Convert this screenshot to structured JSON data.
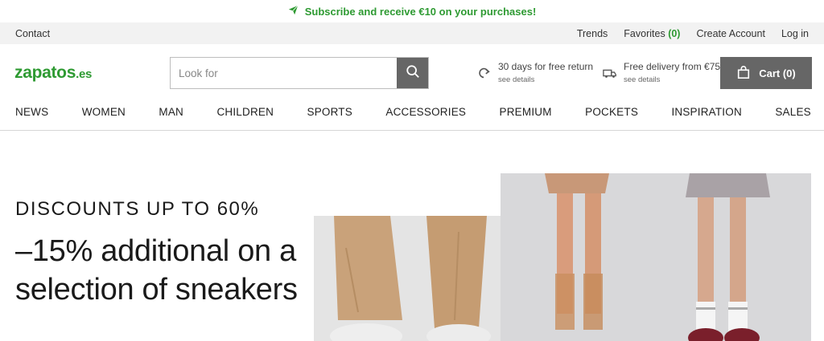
{
  "promo": {
    "text": "Subscribe and receive €10 on your purchases!",
    "icon": "paper-plane-icon",
    "color": "#2e9a32"
  },
  "utility": {
    "contact": "Contact",
    "trends": "Trends",
    "favorites_label": "Favorites",
    "favorites_count": "(0)",
    "create_account": "Create Account",
    "login": "Log in"
  },
  "header": {
    "logo_main": "zapatos",
    "logo_tld": ".es",
    "search_placeholder": "Look for",
    "return_title": "30 days for free return",
    "return_link": "see details",
    "delivery_title": "Free delivery from €75",
    "delivery_link": "see details",
    "cart_label": "Cart (0)"
  },
  "nav": {
    "items": [
      "NEWS",
      "WOMEN",
      "MAN",
      "CHILDREN",
      "SPORTS",
      "ACCESSORIES",
      "PREMIUM",
      "POCKETS",
      "INSPIRATION",
      "SALES"
    ]
  },
  "hero": {
    "kicker": "DISCOUNTS UP TO 60%",
    "headline": "–15% additional on a selection of sneakers"
  },
  "colors": {
    "brand": "#2e9a32",
    "button": "#666666",
    "utility_bg": "#f2f2f2"
  }
}
